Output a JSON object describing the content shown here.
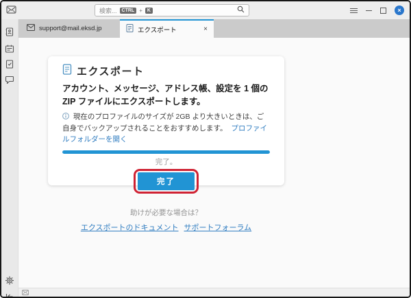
{
  "titlebar": {
    "search_placeholder": "検索...",
    "ctrl_key": "CTRL",
    "plus": "+",
    "k_key": "K"
  },
  "tabs": {
    "mail_tab_label": "support@mail.eksd.jp",
    "export_tab_label": "エクスポート",
    "close_glyph": "×"
  },
  "export_panel": {
    "title": "エクスポート",
    "description": "アカウント、メッセージ、アドレス帳、設定を 1 個の ZIP ファイルにエクスポートします。",
    "note": "現在のプロファイルのサイズが 2GB より大きいときは、ご自身でバックアップされることをおすすめします。",
    "note_link": "プロファイルフォルダーを開く",
    "progress_percent": 100,
    "status": "完了。",
    "done_button": "完了"
  },
  "help": {
    "question": "助けが必要な場合は？",
    "doc_link": "エクスポートのドキュメント",
    "forum_link": "サポートフォーラム"
  },
  "icons": {
    "titlebar_space": "mail-envelope",
    "sidebar": [
      "address-book",
      "calendar",
      "tasks",
      "chat",
      "settings-gear",
      "collapse-arrow"
    ],
    "statusbar": "mail-indicator"
  },
  "colors": {
    "accent_blue": "#2194d4",
    "link_blue": "#2f7cc0",
    "annotation_red": "#cf2233",
    "close_button_blue": "#2a77cc"
  }
}
